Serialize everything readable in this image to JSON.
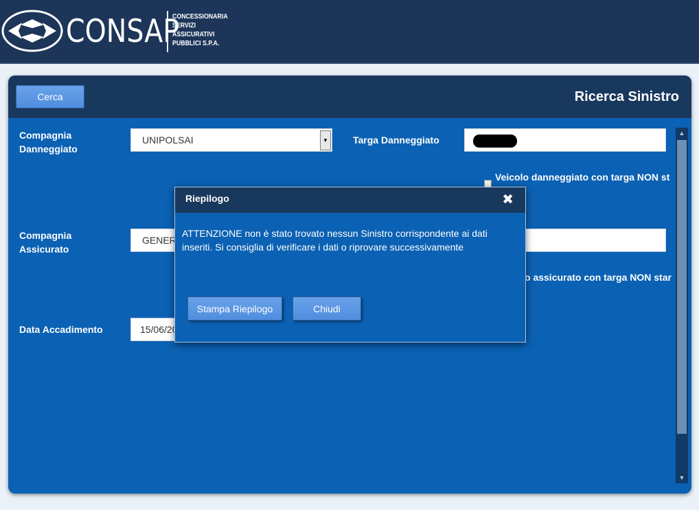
{
  "header": {
    "logo_name": "CONSAP",
    "logo_sub": [
      "CONCESSIONARIA",
      "SERVIZI",
      "ASSICURATIVI",
      "PUBBLICI S.P.A."
    ]
  },
  "panel": {
    "title": "Ricerca Sinistro",
    "search_button": "Cerca"
  },
  "form": {
    "compagnia_danneggiato_label": "Compagnia Danneggiato",
    "compagnia_danneggiato_value": "UNIPOLSAI",
    "targa_danneggiato_label": "Targa Danneggiato",
    "veicolo_danneggiato_check_label": "Veicolo danneggiato con targa NON st",
    "compagnia_assicurato_label": "Compagnia Assicurato",
    "compagnia_assicurato_value": "GENER",
    "veicolo_assicurato_check_label": "o assicurato con targa NON star",
    "data_accadimento_label": "Data Accadimento",
    "data_accadimento_value": "15/06/20"
  },
  "modal": {
    "title": "Riepilogo",
    "close_glyph": "✖",
    "message": "ATTENZIONE non è stato trovato nessun Sinistro corrispondente ai dati inseriti. Si consiglia di verificare i dati o riprovare successivamente",
    "print_button": "Stampa Riepilogo",
    "close_button": "Chiudi"
  },
  "icons": {
    "logo": "consap-diamond-logo",
    "select_arrow": "triangle-down-icon",
    "scroll_up": "triangle-up-icon",
    "scroll_down": "chevron-down-icon"
  },
  "colors": {
    "header_bg": "#1c3558",
    "panel_bg": "#0b61b3",
    "panel_head_bg": "#19385d",
    "button_bg": "#5b97e4"
  }
}
